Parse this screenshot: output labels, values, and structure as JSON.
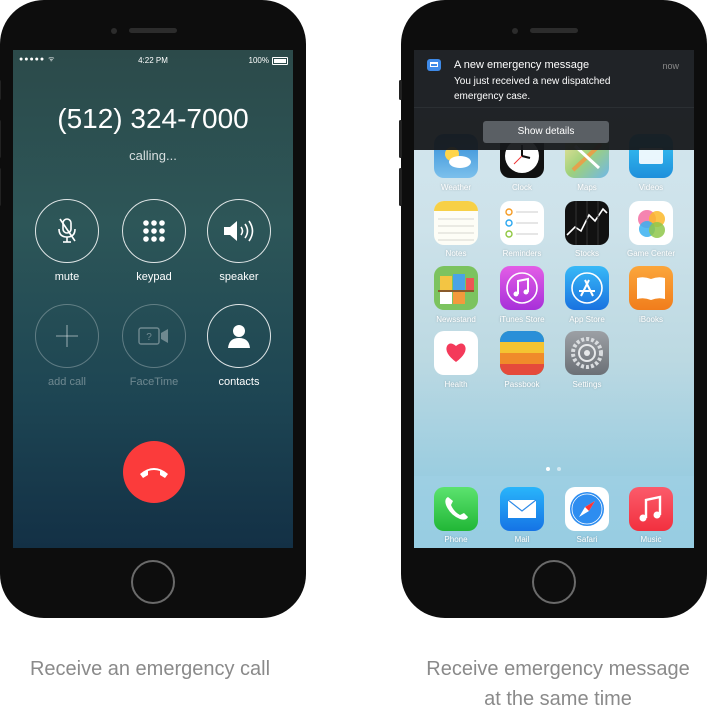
{
  "left_phone": {
    "status_bar": {
      "signal": "●●●●● ᯤ",
      "time": "4:22 PM",
      "battery": "100%"
    },
    "caller_number": "(512) 324-7000",
    "call_status": "calling...",
    "controls": [
      {
        "label": "mute",
        "icon": "mic-off-icon",
        "enabled": true
      },
      {
        "label": "keypad",
        "icon": "keypad-icon",
        "enabled": true
      },
      {
        "label": "speaker",
        "icon": "speaker-icon",
        "enabled": true
      },
      {
        "label": "add call",
        "icon": "plus-icon",
        "enabled": false
      },
      {
        "label": "FaceTime",
        "icon": "facetime-icon",
        "enabled": false
      },
      {
        "label": "contacts",
        "icon": "contacts-icon",
        "enabled": true
      }
    ],
    "end_call_icon": "hangup-icon",
    "end_call_color": "#fb3b3b"
  },
  "right_phone": {
    "notification": {
      "title": "A new emergency message",
      "body": "You just received a new dispatched emergency case.",
      "time": "now",
      "action": "Show details"
    },
    "apps": [
      {
        "label": "Weather"
      },
      {
        "label": "Clock"
      },
      {
        "label": "Maps"
      },
      {
        "label": "Videos"
      },
      {
        "label": "Notes"
      },
      {
        "label": "Reminders"
      },
      {
        "label": "Stocks"
      },
      {
        "label": "Game Center"
      },
      {
        "label": "Newsstand"
      },
      {
        "label": "iTunes Store"
      },
      {
        "label": "App Store"
      },
      {
        "label": "iBooks"
      },
      {
        "label": "Health"
      },
      {
        "label": "Passbook"
      },
      {
        "label": "Settings"
      }
    ],
    "page_count": 2,
    "active_page": 1,
    "dock": [
      {
        "label": "Phone"
      },
      {
        "label": "Mail"
      },
      {
        "label": "Safari"
      },
      {
        "label": "Music"
      }
    ]
  },
  "captions": {
    "left": "Receive an emergency call",
    "right_line1": "Receive emergency message",
    "right_line2": "at the same time"
  }
}
